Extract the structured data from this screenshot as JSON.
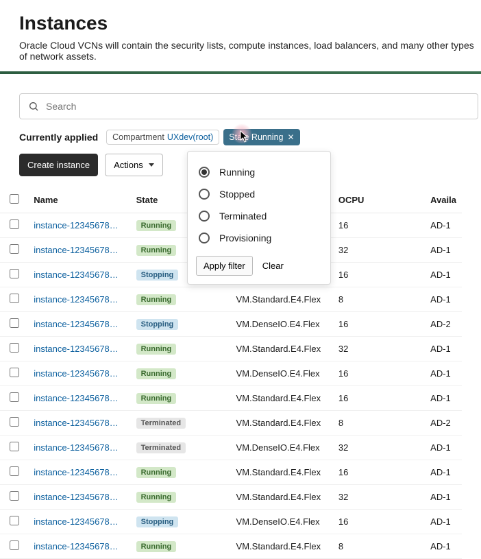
{
  "header": {
    "title": "Instances",
    "description": "Oracle Cloud  VCNs will contain the security lists, compute instances, load balancers, and many other types of network assets."
  },
  "search": {
    "placeholder": "Search"
  },
  "applied": {
    "label": "Currently applied",
    "compartment_chip_prefix": "Compartment ",
    "compartment_chip_value": "UXdev(root)",
    "state_chip_text": "State Running"
  },
  "actions": {
    "create": "Create instance",
    "actions_menu": "Actions"
  },
  "filter_popup": {
    "options": [
      "Running",
      "Stopped",
      "Terminated",
      "Provisioning"
    ],
    "selected": "Running",
    "apply": "Apply filter",
    "clear": "Clear"
  },
  "columns": {
    "name": "Name",
    "state": "State",
    "shape": "",
    "ocpu": "OCPU",
    "avail": "Availa"
  },
  "rows": [
    {
      "name": "instance-12345678-…",
      "state": "Running",
      "shape": "",
      "ocpu": "16",
      "ad": "AD-1"
    },
    {
      "name": "instance-12345678-…",
      "state": "Running",
      "shape": "",
      "ocpu": "32",
      "ad": "AD-1"
    },
    {
      "name": "instance-12345678-…",
      "state": "Stopping",
      "shape": "",
      "ocpu": "16",
      "ad": "AD-1"
    },
    {
      "name": "instance-12345678-…",
      "state": "Running",
      "shape": "VM.Standard.E4.Flex",
      "ocpu": "8",
      "ad": "AD-1"
    },
    {
      "name": "instance-12345678-…",
      "state": "Stopping",
      "shape": "VM.DenseIO.E4.Flex",
      "ocpu": "16",
      "ad": "AD-2"
    },
    {
      "name": "instance-12345678-…",
      "state": "Running",
      "shape": "VM.Standard.E4.Flex",
      "ocpu": "32",
      "ad": "AD-1"
    },
    {
      "name": "instance-12345678-…",
      "state": "Running",
      "shape": "VM.DenseIO.E4.Flex",
      "ocpu": "16",
      "ad": "AD-1"
    },
    {
      "name": "instance-12345678-…",
      "state": "Running",
      "shape": "VM.Standard.E4.Flex",
      "ocpu": "16",
      "ad": "AD-1"
    },
    {
      "name": "instance-12345678-…",
      "state": "Terminated",
      "shape": "VM.Standard.E4.Flex",
      "ocpu": "8",
      "ad": "AD-2"
    },
    {
      "name": "instance-12345678-…",
      "state": "Terminated",
      "shape": "VM.DenseIO.E4.Flex",
      "ocpu": "32",
      "ad": "AD-1"
    },
    {
      "name": "instance-12345678-…",
      "state": "Running",
      "shape": "VM.Standard.E4.Flex",
      "ocpu": "16",
      "ad": "AD-1"
    },
    {
      "name": "instance-12345678-…",
      "state": "Running",
      "shape": "VM.Standard.E4.Flex",
      "ocpu": "32",
      "ad": "AD-1"
    },
    {
      "name": "instance-12345678-…",
      "state": "Stopping",
      "shape": "VM.DenseIO.E4.Flex",
      "ocpu": "16",
      "ad": "AD-1"
    },
    {
      "name": "instance-12345678-…",
      "state": "Running",
      "shape": "VM.Standard.E4.Flex",
      "ocpu": "8",
      "ad": "AD-1"
    }
  ],
  "state_badge_class": {
    "Running": "b-running",
    "Stopping": "b-stopping",
    "Terminated": "b-terminated"
  }
}
